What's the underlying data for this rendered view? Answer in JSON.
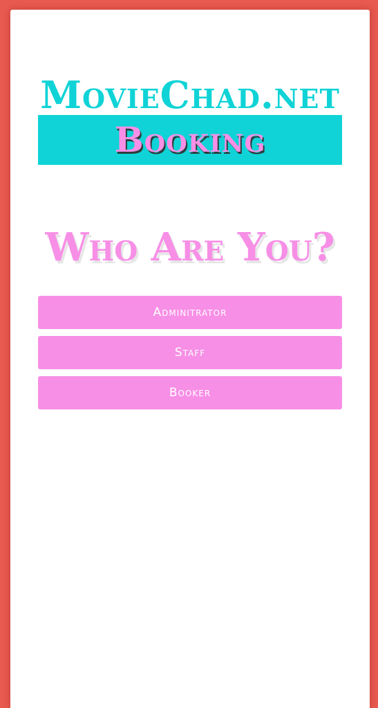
{
  "header": {
    "brand": "MovieChad.net",
    "banner": "Booking"
  },
  "main": {
    "heading": "Who Are You?",
    "roles": [
      {
        "label": "Adminitrator"
      },
      {
        "label": "Staff"
      },
      {
        "label": "Booker"
      }
    ]
  },
  "colors": {
    "page_background": "#e8594f",
    "card_background": "#ffffff",
    "accent_cyan": "#0fd3d6",
    "accent_pink": "#f78fe6"
  }
}
